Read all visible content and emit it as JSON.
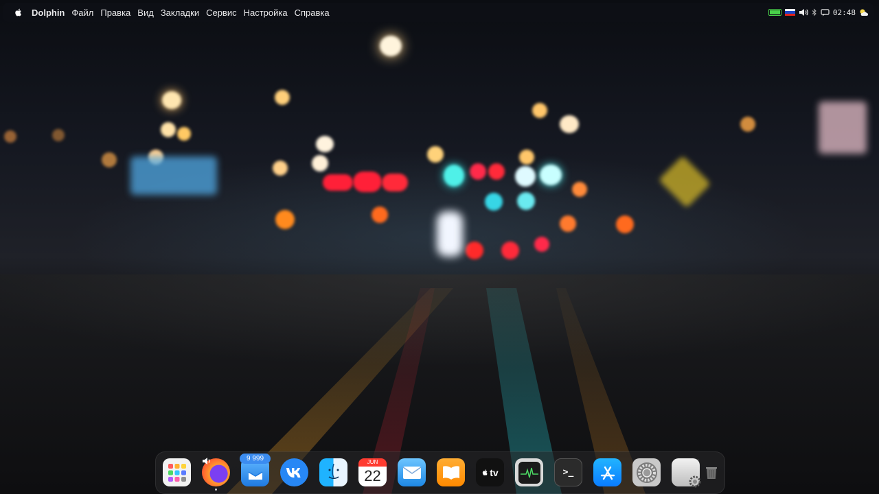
{
  "menubar": {
    "app_name": "Dolphin",
    "items": [
      "Файл",
      "Правка",
      "Вид",
      "Закладки",
      "Сервис",
      "Настройка",
      "Справка"
    ],
    "clock": "02:48"
  },
  "dock": {
    "mail_badge": "9 999",
    "calendar_month": "JUN",
    "calendar_day": "22",
    "tv_label": "tv",
    "terminal_prompt": ">_",
    "apps": [
      "launchpad",
      "firefox",
      "mail-client",
      "vk",
      "finder",
      "calendar",
      "mail",
      "books",
      "apple-tv",
      "activity-monitor",
      "terminal",
      "app-store",
      "system-preferences",
      "settings-manager",
      "trash"
    ]
  },
  "colors": {
    "accent": "#3b8cf0",
    "battery": "#49d24a"
  }
}
